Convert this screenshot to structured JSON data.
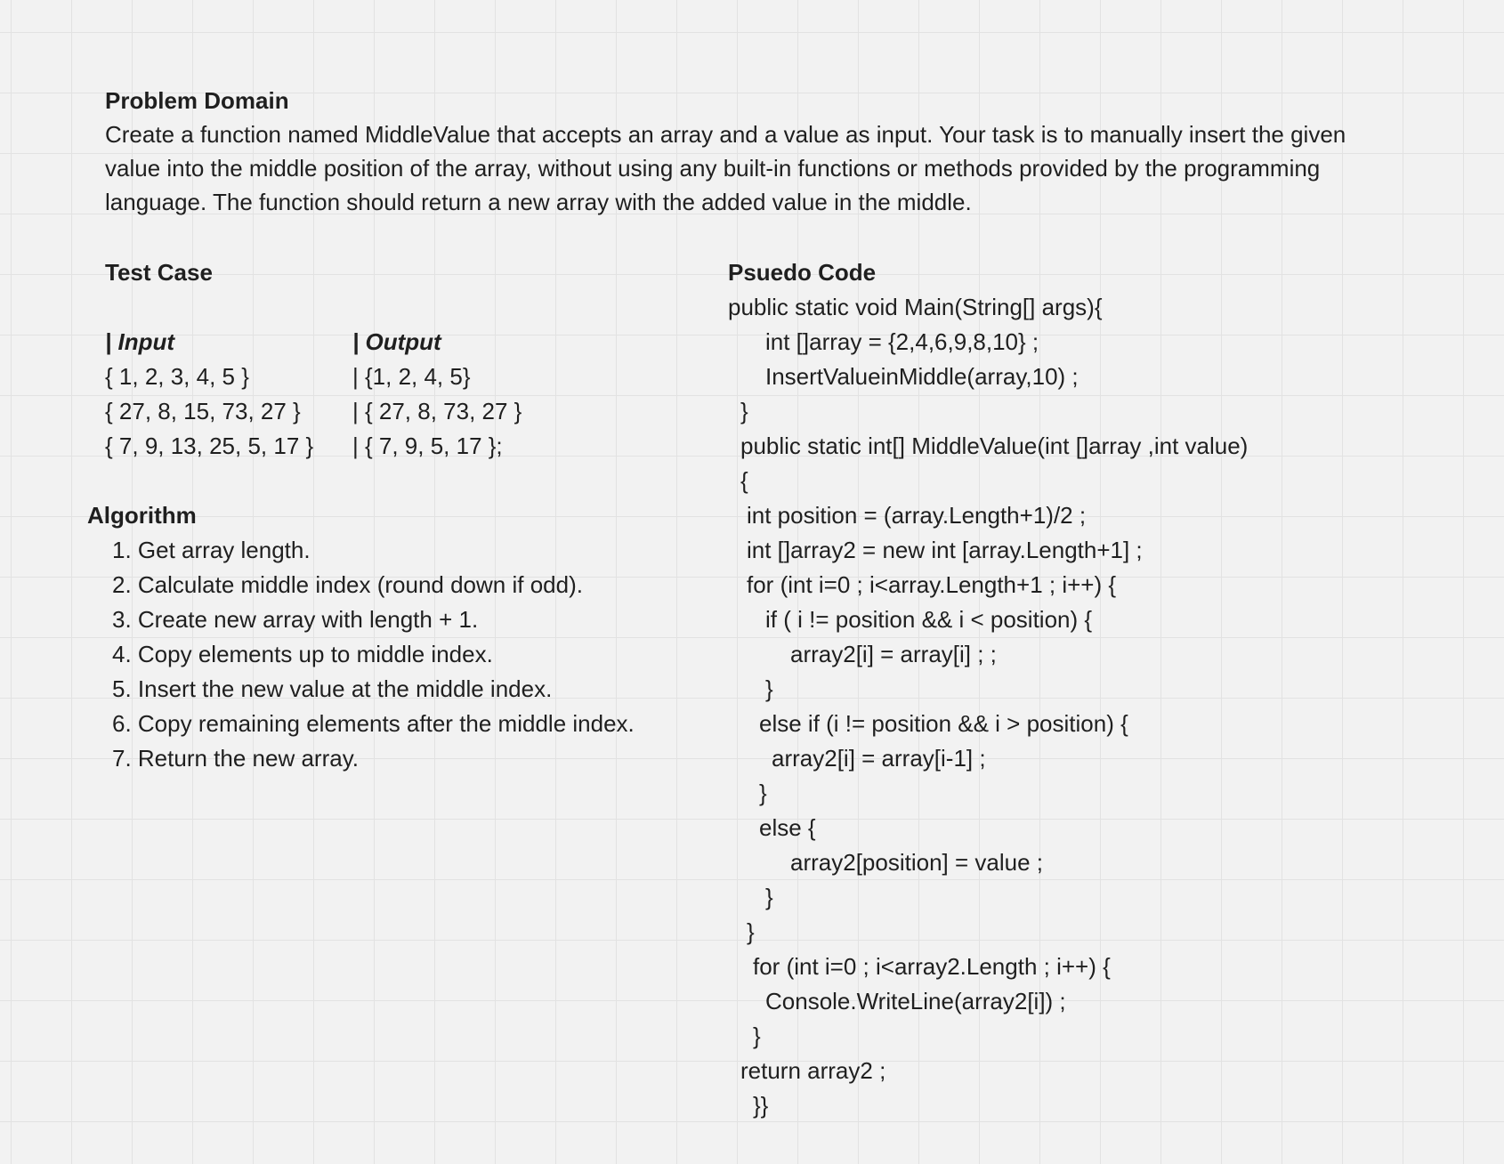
{
  "problem_domain": {
    "heading": "Problem Domain",
    "lines": [
      "Create a function named MiddleValue that accepts an array and a value as input. Your task is to manually insert the given",
      "value into the middle position of the array, without using any built-in functions or methods provided by the programming",
      "language. The function should return a new array with the added value in the middle."
    ]
  },
  "test_case": {
    "heading": "Test Case",
    "input_header": "| Input",
    "output_header": "| Output",
    "rows": [
      {
        "input": "{ 1, 2, 3, 4, 5 }",
        "output": "| {1, 2, 4, 5}"
      },
      {
        "input": "{ 27, 8, 15, 73, 27 }",
        "output": "| { 27, 8, 73, 27 }"
      },
      {
        "input": "{ 7, 9, 13, 25, 5, 17 }",
        "output": "| { 7, 9, 5, 17 };"
      }
    ]
  },
  "algorithm": {
    "heading": "Algorithm",
    "steps": [
      "1. Get array length.",
      "2. Calculate middle index (round down if odd).",
      "3. Create new array with length + 1.",
      "4. Copy elements up to middle index.",
      "5. Insert the new value at the middle index.",
      "6. Copy remaining elements after the middle index.",
      "7. Return the new array."
    ]
  },
  "pseudo_code": {
    "heading": "Psuedo Code",
    "lines": [
      "public static void Main(String[] args){",
      "int []array = {2,4,6,9,8,10} ;",
      "InsertValueinMiddle(array,10) ;",
      "}",
      "public static int[] MiddleValue(int []array ,int value)",
      "{",
      "int position = (array.Length+1)/2 ;",
      "int []array2 = new int [array.Length+1] ;",
      "for (int i=0 ; i<array.Length+1 ; i++) {",
      "if ( i != position && i < position) {",
      "array2[i] = array[i] ; ;",
      "}",
      "else if (i != position && i > position) {",
      "array2[i] = array[i-1] ;",
      "}",
      "else {",
      "array2[position] = value ;",
      "}",
      "}",
      "for (int i=0 ; i<array2.Length ; i++) {",
      "Console.WriteLine(array2[i]) ;",
      "}",
      "return array2 ;",
      "}}"
    ]
  }
}
